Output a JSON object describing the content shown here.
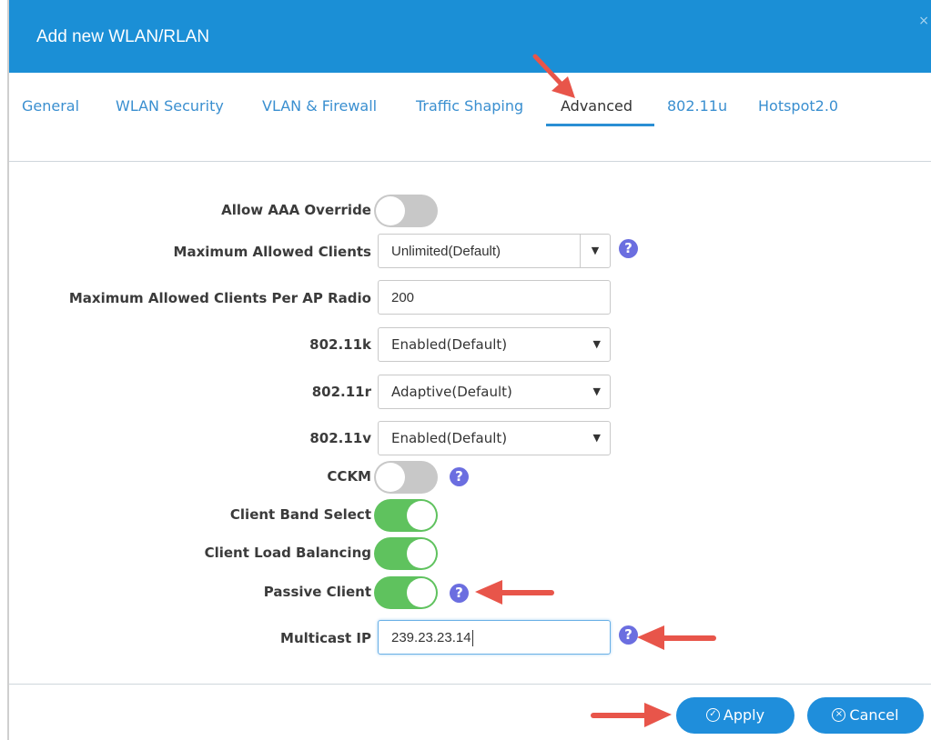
{
  "dialog": {
    "title": "Add new WLAN/RLAN",
    "close_glyph": "×"
  },
  "tabs": [
    {
      "label": "General",
      "active": false
    },
    {
      "label": "WLAN Security",
      "active": false
    },
    {
      "label": "VLAN & Firewall",
      "active": false
    },
    {
      "label": "Traffic Shaping",
      "active": false
    },
    {
      "label": "Advanced",
      "active": true
    },
    {
      "label": "802.11u",
      "active": false
    },
    {
      "label": "Hotspot2.0",
      "active": false
    }
  ],
  "fields": {
    "aaa_override": {
      "label": "Allow AAA Override",
      "state": "off"
    },
    "max_clients": {
      "label": "Maximum Allowed Clients",
      "value": "Unlimited(Default)"
    },
    "max_clients_ap": {
      "label": "Maximum Allowed Clients Per AP Radio",
      "value": "200"
    },
    "dot11k": {
      "label": "802.11k",
      "value": "Enabled(Default)"
    },
    "dot11r": {
      "label": "802.11r",
      "value": "Adaptive(Default)"
    },
    "dot11v": {
      "label": "802.11v",
      "value": "Enabled(Default)"
    },
    "cckm": {
      "label": "CCKM",
      "state": "off"
    },
    "band_select": {
      "label": "Client Band Select",
      "state": "on"
    },
    "load_balancing": {
      "label": "Client Load Balancing",
      "state": "on"
    },
    "passive_client": {
      "label": "Passive Client",
      "state": "on"
    },
    "multicast_ip": {
      "label": "Multicast IP",
      "value": "239.23.23.14"
    }
  },
  "icons": {
    "help_glyph": "?",
    "dropdown_glyph": "▼",
    "apply_glyph": "✓",
    "cancel_glyph": "×"
  },
  "buttons": {
    "apply": "Apply",
    "cancel": "Cancel"
  },
  "colors": {
    "header": "#1b8fd6",
    "toggle_on": "#5fc25e",
    "toggle_off": "#c8c8c8",
    "help": "#6b6ee0",
    "button": "#1f8edb",
    "annotation_arrow": "#e8554a"
  }
}
